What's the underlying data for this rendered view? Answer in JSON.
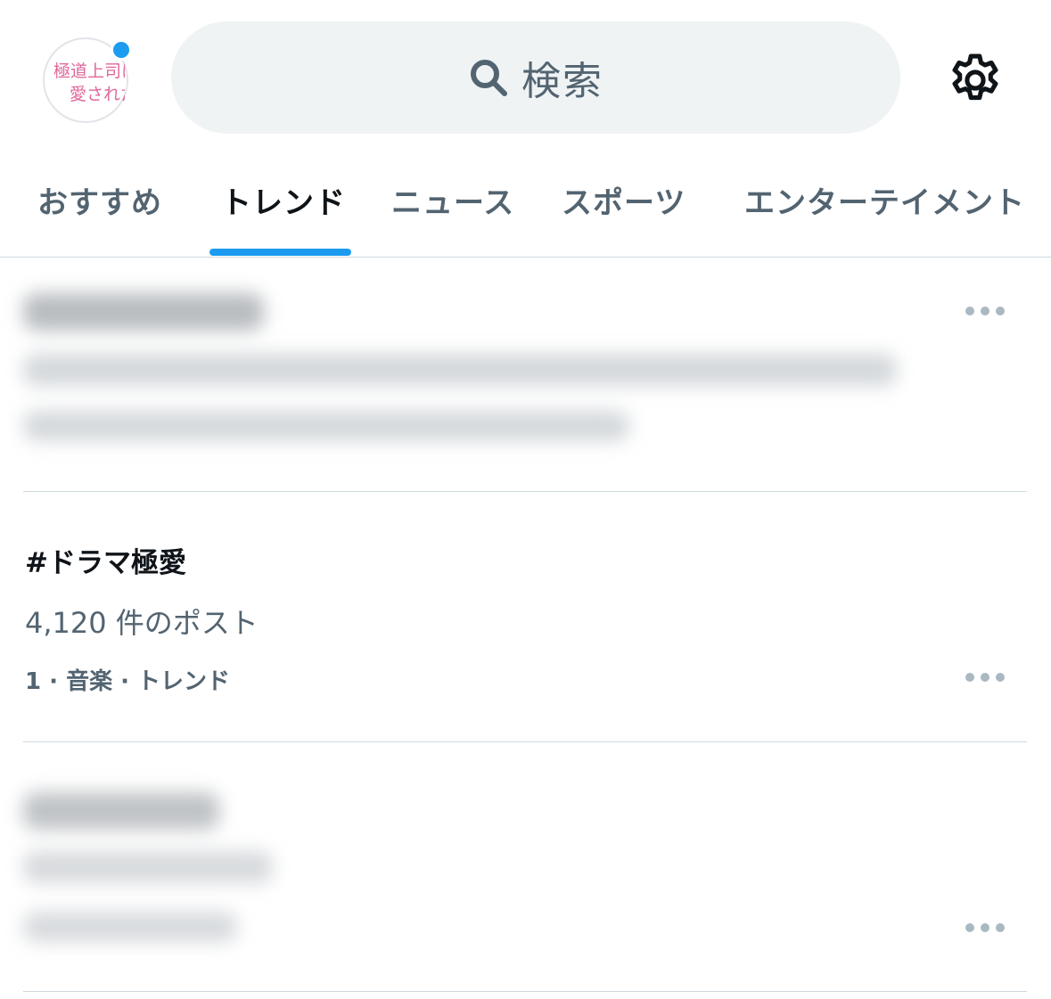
{
  "header": {
    "avatar_alt": "極道上司に愛されたら",
    "search": {
      "placeholder": "検索"
    }
  },
  "tabs": [
    {
      "label": "おすすめ",
      "active": false
    },
    {
      "label": "トレンド",
      "active": true
    },
    {
      "label": "ニュース",
      "active": false
    },
    {
      "label": "スポーツ",
      "active": false
    },
    {
      "label": "エンターテイメント",
      "active": false
    }
  ],
  "trends": [
    {
      "blurred": true
    },
    {
      "title": "#ドラマ極愛",
      "count": "4,120 件のポスト",
      "meta": "1 · 音楽 · トレンド"
    },
    {
      "blurred": true
    }
  ],
  "colors": {
    "accent": "#1d9bf0",
    "text_primary": "#0f1419",
    "text_secondary": "#536471",
    "search_bg": "#eff3f4",
    "divider": "#cfd9de",
    "avatar_text": "#e0679a"
  },
  "icons": {
    "search": "search-icon",
    "settings": "gear-icon",
    "more": "more-horizontal-icon"
  }
}
